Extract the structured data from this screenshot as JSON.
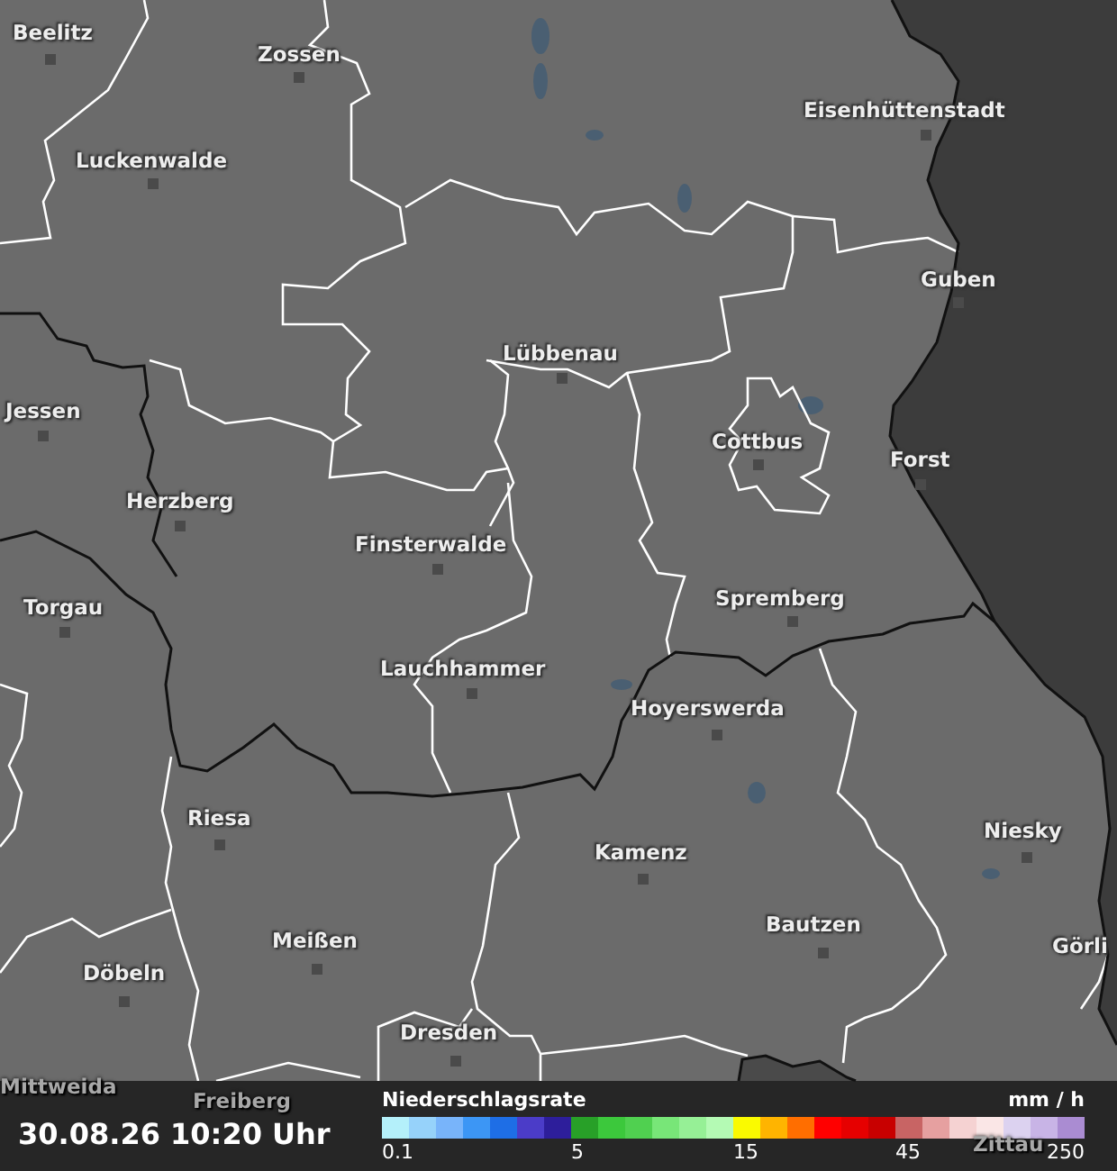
{
  "map": {
    "cities": [
      "Beelitz",
      "Zossen",
      "Luckenwalde",
      "Eisenhüttenstadt",
      "Guben",
      "Lübbenau",
      "Jessen",
      "Cottbus",
      "Forst",
      "Herzberg",
      "Finsterwalde",
      "Torgau",
      "Spremberg",
      "Lauchhammer",
      "Hoyerswerda",
      "Riesa",
      "Kamenz",
      "Niesky",
      "Bautzen",
      "Meißen",
      "Görli",
      "Döbeln",
      "Dresden",
      "Mittweida",
      "Freiberg",
      "Zittau"
    ]
  },
  "timestamp": "30.08.26 10:20 Uhr",
  "legend": {
    "title": "Niederschlagsrate",
    "unit": "mm / h",
    "swatches": [
      {
        "color": "#b4f0fa"
      },
      {
        "color": "#96d2fa"
      },
      {
        "color": "#78b4fa"
      },
      {
        "color": "#3c96f5"
      },
      {
        "color": "#1e6ee6"
      },
      {
        "color": "#4b3cc8"
      },
      {
        "color": "#2d1e9b"
      },
      {
        "color": "#28a028"
      },
      {
        "color": "#3cc83c"
      },
      {
        "color": "#50d050"
      },
      {
        "color": "#78e678"
      },
      {
        "color": "#96f096"
      },
      {
        "color": "#b4fab4"
      },
      {
        "color": "#fafa00"
      },
      {
        "color": "#ffb400"
      },
      {
        "color": "#ff6e00"
      },
      {
        "color": "#ff0000"
      },
      {
        "color": "#e60000"
      },
      {
        "color": "#c80000"
      },
      {
        "color": "#c86464"
      },
      {
        "color": "#e6a0a0"
      },
      {
        "color": "#f5d2d2"
      },
      {
        "color": "#fae6e6"
      },
      {
        "color": "#dcd2f0"
      },
      {
        "color": "#c8b4e6"
      },
      {
        "color": "#aa8cd2"
      }
    ],
    "ticks": [
      "0.1",
      "5",
      "15",
      "45",
      "250"
    ]
  }
}
